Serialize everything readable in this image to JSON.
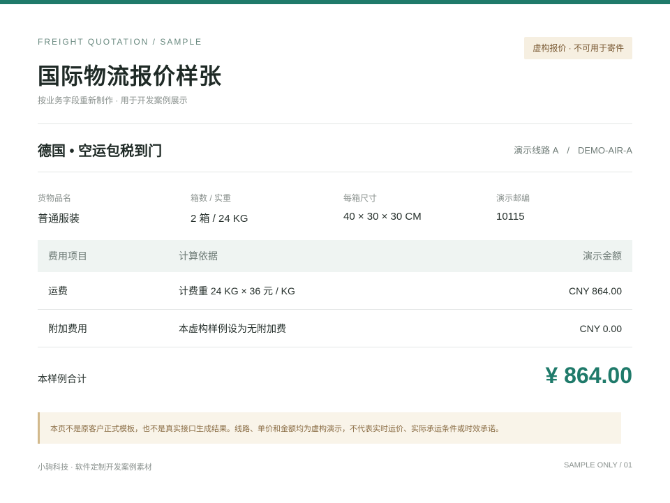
{
  "header": {
    "eyebrow": "FREIGHT QUOTATION / SAMPLE",
    "badge": "虚构报价 · 不可用于寄件",
    "title": "国际物流报价样张",
    "subtitle": "按业务字段重新制作 · 用于开发案例展示"
  },
  "route": {
    "title": "德国 • 空运包税到门",
    "line_label": "演示线路 A",
    "separator": "/",
    "code": "DEMO-AIR-A"
  },
  "info": [
    {
      "label": "货物品名",
      "value": "普通服装"
    },
    {
      "label": "箱数 / 实重",
      "value": "2 箱 / 24 KG"
    },
    {
      "label": "每箱尺寸",
      "value": "40 × 30 × 30 CM"
    },
    {
      "label": "演示邮编",
      "value": "10115"
    }
  ],
  "fees": {
    "headers": [
      "费用项目",
      "计算依据",
      "演示金额"
    ],
    "rows": [
      [
        "运费",
        "计费重 24 KG × 36 元 / KG",
        "CNY 864.00"
      ],
      [
        "附加费用",
        "本虚构样例设为无附加费",
        "CNY 0.00"
      ]
    ]
  },
  "total": {
    "label": "本样例合计",
    "value": "¥ 864.00"
  },
  "notice": "本页不是原客户正式模板，也不是真实接口生成结果。线路、单价和金额均为虚构演示，不代表实时运价、实际承运条件或时效承诺。",
  "footer": {
    "left": "小驹科技 · 软件定制开发案例素材",
    "right": "SAMPLE ONLY / 01"
  },
  "colors": {
    "accent": "#1f7a6a",
    "badge_bg": "#f6efe1",
    "notice_bg": "#f9f4e9",
    "table_head_bg": "#eff4f2"
  }
}
